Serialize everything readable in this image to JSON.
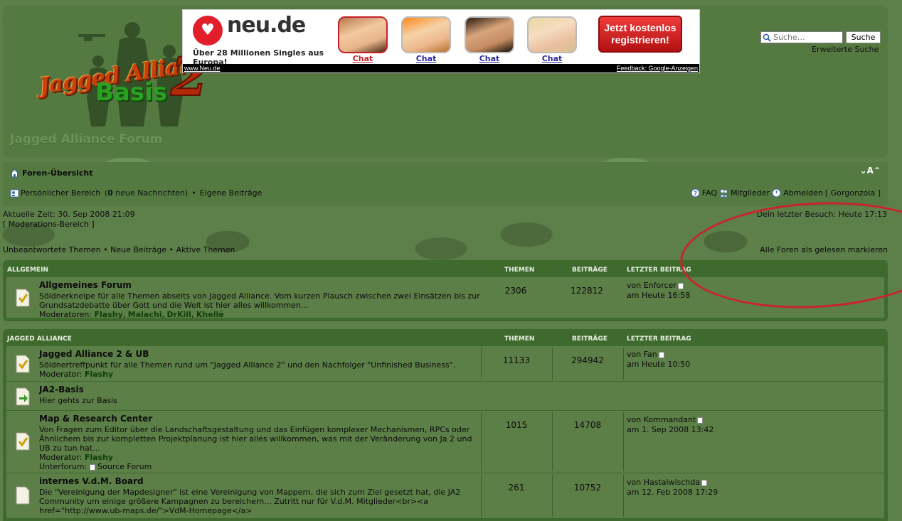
{
  "site": {
    "title": "Jagged Alliance Forum",
    "logo_line1": "Jagged Alliance",
    "logo_line2": "Basis",
    "logo_number": "2"
  },
  "ad": {
    "brand": "neu.de",
    "tagline": "Über 28 Millionen Singles aus Europa!",
    "chat_labels": [
      "Chat",
      "Chat",
      "Chat",
      "Chat"
    ],
    "cta": "Jetzt kostenlos registrieren!",
    "footer_left": "www.Neu.de",
    "footer_right": "Feedback: Google-Anzeigen"
  },
  "search": {
    "placeholder": "Suche…",
    "button": "Suche",
    "advanced": "Erweiterte Suche"
  },
  "nav": {
    "breadcrumb": "Foren-Übersicht",
    "font_size_toggle": "A",
    "personal_area": "Persönlicher Bereich",
    "new_messages_prefix": "(",
    "new_messages_count": "0",
    "new_messages_suffix": " neue Nachrichten)",
    "own_posts": "Eigene Beiträge",
    "faq": "FAQ",
    "members": "Mitglieder",
    "logout": "Abmelden",
    "username": "[ Gorgonzola ]",
    "separator": "•"
  },
  "status": {
    "current_time": "Aktuelle Zeit: 30. Sep 2008 21:09",
    "moderation": "[ Moderations-Bereich ]",
    "last_visit": "Dein letzter Besuch: Heute 17:13"
  },
  "links": {
    "unanswered": "Unbeantwortete Themen",
    "new_posts": "Neue Beiträge",
    "active": "Aktive Themen",
    "mark_read": "Alle Foren als gelesen markieren"
  },
  "columns": {
    "topics": "THEMEN",
    "posts": "BEITRÄGE",
    "last_post": "LETZTER BEITRAG"
  },
  "categories": [
    {
      "name": "ALLGEMEIN",
      "forums": [
        {
          "title": "Allgemeines Forum",
          "desc": "Söldnerkneipe für alle Themen abseits von Jagged Alliance. Vom kurzen Plausch zwischen zwei Einsätzen bis zur Grundsatzdebatte über Gott und die Welt ist hier alles willkommen...",
          "mod_label": "Moderatoren:",
          "mods": [
            "Flashy",
            "Malachi",
            "DrKill",
            "Khellè"
          ],
          "topics": "2306",
          "posts": "122812",
          "last_by": "von Enforcer",
          "last_at": "am Heute 16:58"
        }
      ]
    },
    {
      "name": "JAGGED ALLIANCE",
      "forums": [
        {
          "title": "Jagged Alliance 2 & UB",
          "desc": "Söldnertreffpunkt für alle Themen rund um \"Jagged Alliance 2\" und den Nachfolger \"Unfinished Business\".",
          "mod_label": "Moderator:",
          "mods": [
            "Flashy"
          ],
          "topics": "11133",
          "posts": "294942",
          "last_by": "von Fan",
          "last_at": "am Heute 10:50"
        },
        {
          "title": "JA2-Basis",
          "desc": "Hier gehts zur Basis"
        },
        {
          "title": "Map & Research Center",
          "desc": "Von Fragen zum Editor über die Landschaftsgestaltung und das Einfügen komplexer Mechanismen, RPCs oder Ähnlichem bis zur kompletten Projektplanung ist hier alles willkommen, was mit der Veränderung von Ja 2 und UB zu tun hat...",
          "mod_label": "Moderator:",
          "mods": [
            "Flashy"
          ],
          "sub_label": "Unterforum:",
          "sub": "Source Forum",
          "topics": "1015",
          "posts": "14708",
          "last_by": "von Kommandant",
          "last_at": "am 1. Sep 2008 13:42"
        },
        {
          "title": "internes V.d.M. Board",
          "desc": "Die \"Vereinigung der Mapdesigner\" ist eine Vereinigung von Mappern, die sich zum Ziel gesetzt hat, die JA2 Community um einige größere Kampagnen zu bereichern... Zutritt nur für V.d.M. Mitglieder<br><a href=\"http://www.ub-maps.de/\">VdM-Homepage</a>",
          "topics": "261",
          "posts": "10752",
          "last_by": "von Hastalwischda",
          "last_at": "am 12. Feb 2008 17:29"
        }
      ]
    }
  ]
}
